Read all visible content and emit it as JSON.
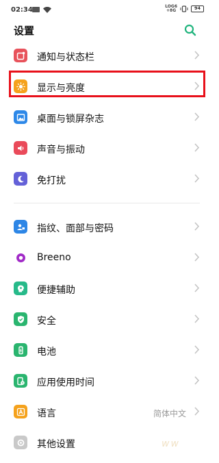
{
  "status_bar": {
    "time": "02:34",
    "net_line1": "LOG6",
    "net_line2": "+8G",
    "battery": "94"
  },
  "header": {
    "title": "设置"
  },
  "colors": {
    "accent_search": "#20b47d",
    "highlight": "#e8101a"
  },
  "settings": {
    "notifications": {
      "label": "通知与状态栏",
      "icon": "notification-icon",
      "color": "#e8525b"
    },
    "display": {
      "label": "显示与亮度",
      "icon": "sun-icon",
      "color": "#f5a21d"
    },
    "desktop": {
      "label": "桌面与锁屏杂志",
      "icon": "picture-icon",
      "color": "#2d88e8"
    },
    "sound": {
      "label": "声音与振动",
      "icon": "speaker-icon",
      "color": "#ea4a5a"
    },
    "dnd": {
      "label": "免打扰",
      "icon": "moon-icon",
      "color": "#6461d8"
    },
    "biometrics": {
      "label": "指纹、面部与密码",
      "icon": "user-lock-icon",
      "color": "#2d86e6"
    },
    "breeno": {
      "label": "Breeno",
      "icon": "breeno-icon",
      "color": "#a12ac7"
    },
    "accessibility": {
      "label": "便捷辅助",
      "icon": "accessibility-icon",
      "color": "#27ba8a"
    },
    "security": {
      "label": "安全",
      "icon": "shield-icon",
      "color": "#2ab56f"
    },
    "battery": {
      "label": "电池",
      "icon": "battery-icon",
      "color": "#2ab56f"
    },
    "screen_time": {
      "label": "应用使用时间",
      "icon": "app-time-icon",
      "color": "#2ab56f"
    },
    "language": {
      "label": "语言",
      "value": "简体中文",
      "icon": "language-icon",
      "color": "#f5a21d"
    },
    "other": {
      "label": "其他设置",
      "icon": "gear-icon",
      "color": "#c9c9c9"
    }
  },
  "watermark": "ww"
}
